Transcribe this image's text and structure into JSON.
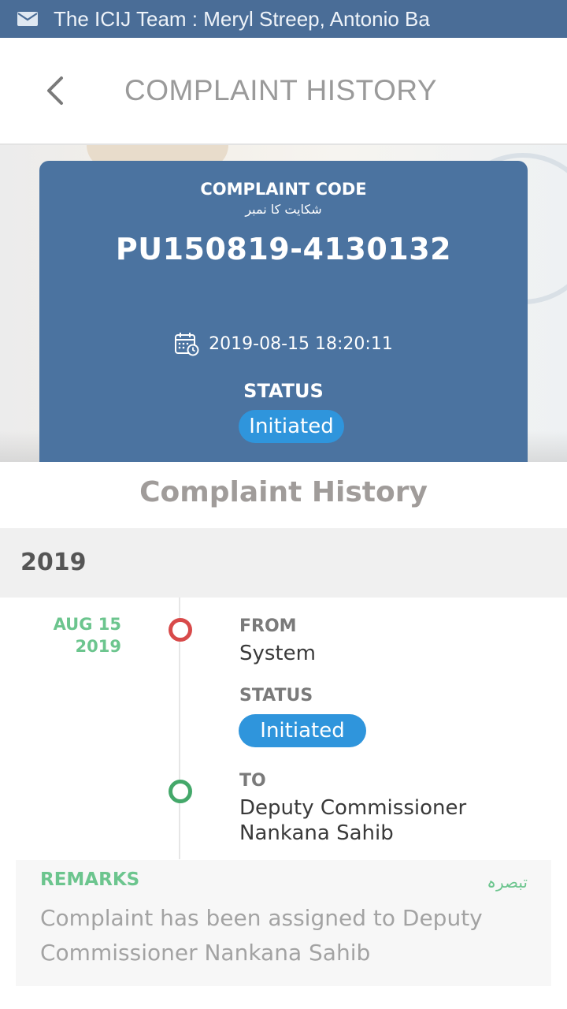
{
  "notification": {
    "text": "The ICIJ Team : Meryl Streep, Antonio Ba",
    "icon": "mail-icon"
  },
  "header": {
    "title": "COMPLAINT HISTORY",
    "back_icon": "chevron-left-icon"
  },
  "card": {
    "code_label": "COMPLAINT CODE",
    "code_label_urdu": "شکایت کا نمبر",
    "code_value": "PU150819-4130132",
    "datetime": "2019-08-15 18:20:11",
    "status_label": "STATUS",
    "status_value": "Initiated"
  },
  "history": {
    "section_title": "Complaint History",
    "year": "2019",
    "entries": [
      {
        "date_month": "AUG 15",
        "date_year": "2019",
        "from_label": "FROM",
        "from_value": "System",
        "status_label": "STATUS",
        "status_value": "Initiated",
        "to_label": "TO",
        "to_value": "Deputy Commissioner Nankana Sahib"
      }
    ]
  },
  "remarks": {
    "label": "REMARKS",
    "label_urdu": "تبصرہ",
    "text": "Complaint has been assigned to Deputy Commissioner Nankana Sahib"
  },
  "colors": {
    "notification_bar": "#4a6d97",
    "card": "#4b73a0",
    "status_pill": "#2f95dc",
    "accent_green": "#6cc58e",
    "dot_red": "#d84a4a",
    "dot_green": "#44a86a"
  }
}
